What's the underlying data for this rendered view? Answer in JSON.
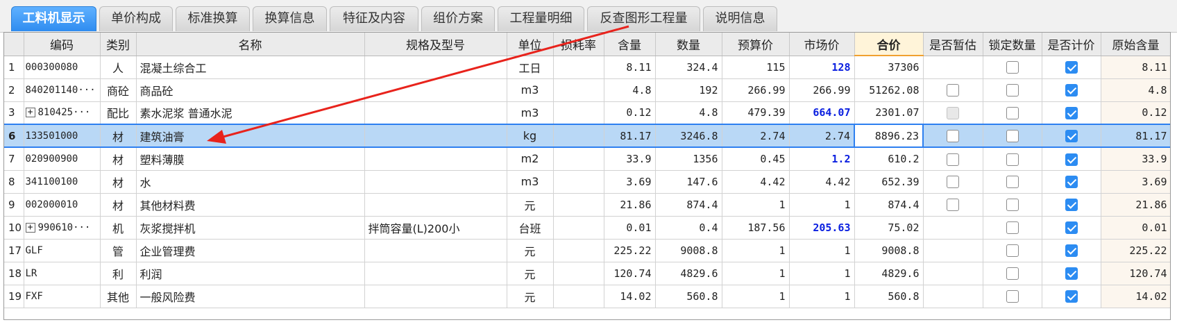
{
  "tabs": [
    {
      "label": "工料机显示",
      "active": true
    },
    {
      "label": "单价构成",
      "active": false
    },
    {
      "label": "标准换算",
      "active": false
    },
    {
      "label": "换算信息",
      "active": false
    },
    {
      "label": "特征及内容",
      "active": false
    },
    {
      "label": "组价方案",
      "active": false
    },
    {
      "label": "工程量明细",
      "active": false
    },
    {
      "label": "反查图形工程量",
      "active": false
    },
    {
      "label": "说明信息",
      "active": false
    }
  ],
  "columns": {
    "rownum": "",
    "code": "编码",
    "category": "类别",
    "name": "名称",
    "spec": "规格及型号",
    "unit": "单位",
    "loss": "损耗率",
    "content": "含量",
    "qty": "数量",
    "budget_price": "预算价",
    "market_price": "市场价",
    "total": "合价",
    "provisional": "是否暂估",
    "lock_qty": "锁定数量",
    "priced": "是否计价",
    "orig_content": "原始含量"
  },
  "rows": [
    {
      "rownum": "1",
      "code": "000300080",
      "expandable": false,
      "category": "人",
      "name": "混凝土综合工",
      "spec": "",
      "unit": "工日",
      "loss": "",
      "content": "8.11",
      "qty": "324.4",
      "budget_price": "115",
      "market_price": "128",
      "market_highlight": true,
      "total": "37306",
      "provisional": null,
      "lock_qty": false,
      "priced": true,
      "orig_content": "8.11"
    },
    {
      "rownum": "2",
      "code": "840201140···",
      "expandable": false,
      "category": "商砼",
      "name": "商品砼",
      "spec": "",
      "unit": "m3",
      "loss": "",
      "content": "4.8",
      "qty": "192",
      "budget_price": "266.99",
      "market_price": "266.99",
      "market_highlight": false,
      "total": "51262.08",
      "provisional": "unchecked",
      "lock_qty": false,
      "priced": true,
      "orig_content": "4.8"
    },
    {
      "rownum": "3",
      "code": "810425···",
      "expandable": true,
      "category": "配比",
      "name": "素水泥浆 普通水泥",
      "spec": "",
      "unit": "m3",
      "loss": "",
      "content": "0.12",
      "qty": "4.8",
      "budget_price": "479.39",
      "market_price": "664.07",
      "market_highlight": true,
      "total": "2301.07",
      "provisional": "disabled",
      "lock_qty": false,
      "priced": true,
      "orig_content": "0.12"
    },
    {
      "rownum": "6",
      "code": "133501000",
      "expandable": false,
      "category": "材",
      "name": "建筑油膏",
      "spec": "",
      "unit": "kg",
      "loss": "",
      "content": "81.17",
      "qty": "3246.8",
      "budget_price": "2.74",
      "market_price": "2.74",
      "market_highlight": false,
      "total": "8896.23",
      "provisional": "unchecked",
      "lock_qty": false,
      "priced": true,
      "orig_content": "81.17",
      "selected": true
    },
    {
      "rownum": "7",
      "code": "020900900",
      "expandable": false,
      "category": "材",
      "name": "塑料薄膜",
      "spec": "",
      "unit": "m2",
      "loss": "",
      "content": "33.9",
      "qty": "1356",
      "budget_price": "0.45",
      "market_price": "1.2",
      "market_highlight": true,
      "total": "610.2",
      "provisional": "unchecked",
      "lock_qty": false,
      "priced": true,
      "orig_content": "33.9"
    },
    {
      "rownum": "8",
      "code": "341100100",
      "expandable": false,
      "category": "材",
      "name": "水",
      "spec": "",
      "unit": "m3",
      "loss": "",
      "content": "3.69",
      "qty": "147.6",
      "budget_price": "4.42",
      "market_price": "4.42",
      "market_highlight": false,
      "total": "652.39",
      "provisional": "unchecked",
      "lock_qty": false,
      "priced": true,
      "orig_content": "3.69"
    },
    {
      "rownum": "9",
      "code": "002000010",
      "expandable": false,
      "category": "材",
      "name": "其他材料费",
      "spec": "",
      "unit": "元",
      "loss": "",
      "content": "21.86",
      "qty": "874.4",
      "budget_price": "1",
      "market_price": "1",
      "market_highlight": false,
      "total": "874.4",
      "provisional": "unchecked",
      "lock_qty": false,
      "priced": true,
      "orig_content": "21.86"
    },
    {
      "rownum": "10",
      "code": "990610···",
      "expandable": true,
      "category": "机",
      "name": "灰浆搅拌机",
      "spec": "拌筒容量(L)200小",
      "unit": "台班",
      "loss": "",
      "content": "0.01",
      "qty": "0.4",
      "budget_price": "187.56",
      "market_price": "205.63",
      "market_highlight": true,
      "total": "75.02",
      "provisional": null,
      "lock_qty": false,
      "priced": true,
      "orig_content": "0.01"
    },
    {
      "rownum": "17",
      "code": "GLF",
      "expandable": false,
      "category": "管",
      "name": "企业管理费",
      "spec": "",
      "unit": "元",
      "loss": "",
      "content": "225.22",
      "qty": "9008.8",
      "budget_price": "1",
      "market_price": "1",
      "market_highlight": false,
      "total": "9008.8",
      "provisional": null,
      "lock_qty": false,
      "priced": true,
      "orig_content": "225.22"
    },
    {
      "rownum": "18",
      "code": "LR",
      "expandable": false,
      "category": "利",
      "name": "利润",
      "spec": "",
      "unit": "元",
      "loss": "",
      "content": "120.74",
      "qty": "4829.6",
      "budget_price": "1",
      "market_price": "1",
      "market_highlight": false,
      "total": "4829.6",
      "provisional": null,
      "lock_qty": false,
      "priced": true,
      "orig_content": "120.74"
    },
    {
      "rownum": "19",
      "code": "FXF",
      "expandable": false,
      "category": "其他",
      "name": "一般风险费",
      "spec": "",
      "unit": "元",
      "loss": "",
      "content": "14.02",
      "qty": "560.8",
      "budget_price": "1",
      "market_price": "1",
      "market_highlight": false,
      "total": "560.8",
      "provisional": null,
      "lock_qty": false,
      "priced": true,
      "orig_content": "14.02"
    }
  ],
  "annotation": {
    "color": "#e8231c"
  },
  "colors": {
    "accent": "#2f8cf0",
    "selection": "#b9d8f6",
    "highlight_text": "#0a1fe0"
  }
}
